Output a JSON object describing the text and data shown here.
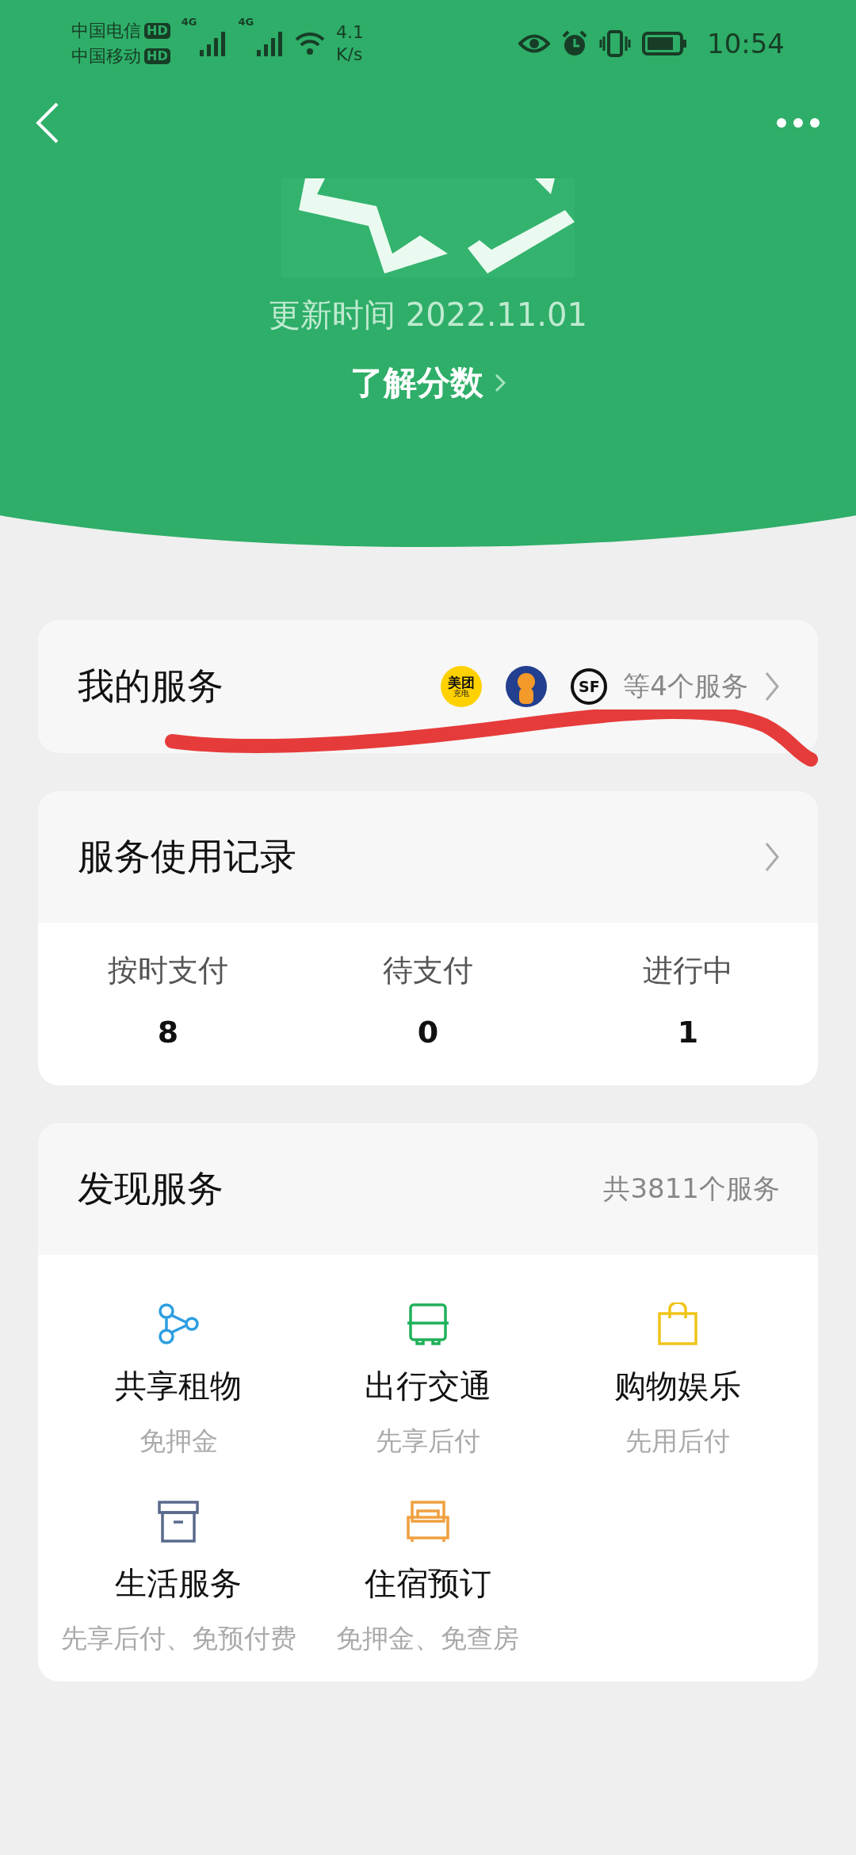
{
  "status_bar": {
    "carriers": [
      {
        "name": "中国电信",
        "badge": "HD"
      },
      {
        "name": "中国移动",
        "badge": "HD"
      }
    ],
    "network": [
      "4G",
      "4G"
    ],
    "speed": [
      "4.1",
      "K/s"
    ],
    "time": "10:54"
  },
  "header": {
    "update_time": "更新时间 2022.11.01",
    "link": "了解分数"
  },
  "my_services": {
    "title": "我的服务",
    "logos": [
      {
        "kind": "meituan",
        "label": "美团",
        "sub": "充电"
      },
      {
        "kind": "tiger"
      },
      {
        "kind": "sf",
        "label": "SF"
      }
    ],
    "summary": "等4个服务"
  },
  "usage_record": {
    "title": "服务使用记录",
    "stats": [
      {
        "label": "按时支付",
        "value": "8"
      },
      {
        "label": "待支付",
        "value": "0"
      },
      {
        "label": "进行中",
        "value": "1"
      }
    ]
  },
  "discover": {
    "title": "发现服务",
    "count": "共3811个服务",
    "items": [
      {
        "kind": "share",
        "title": "共享租物",
        "subtitle": "免押金",
        "color": "#2d9ee0"
      },
      {
        "kind": "bus",
        "title": "出行交通",
        "subtitle": "先享后付",
        "color": "#20b05a"
      },
      {
        "kind": "bag",
        "title": "购物娱乐",
        "subtitle": "先用后付",
        "color": "#f0c419"
      },
      {
        "kind": "box",
        "title": "生活服务",
        "subtitle": "先享后付、免预付费",
        "color": "#5a6a8c"
      },
      {
        "kind": "bed",
        "title": "住宿预订",
        "subtitle": "免押金、免查房",
        "color": "#f0a040"
      }
    ]
  }
}
